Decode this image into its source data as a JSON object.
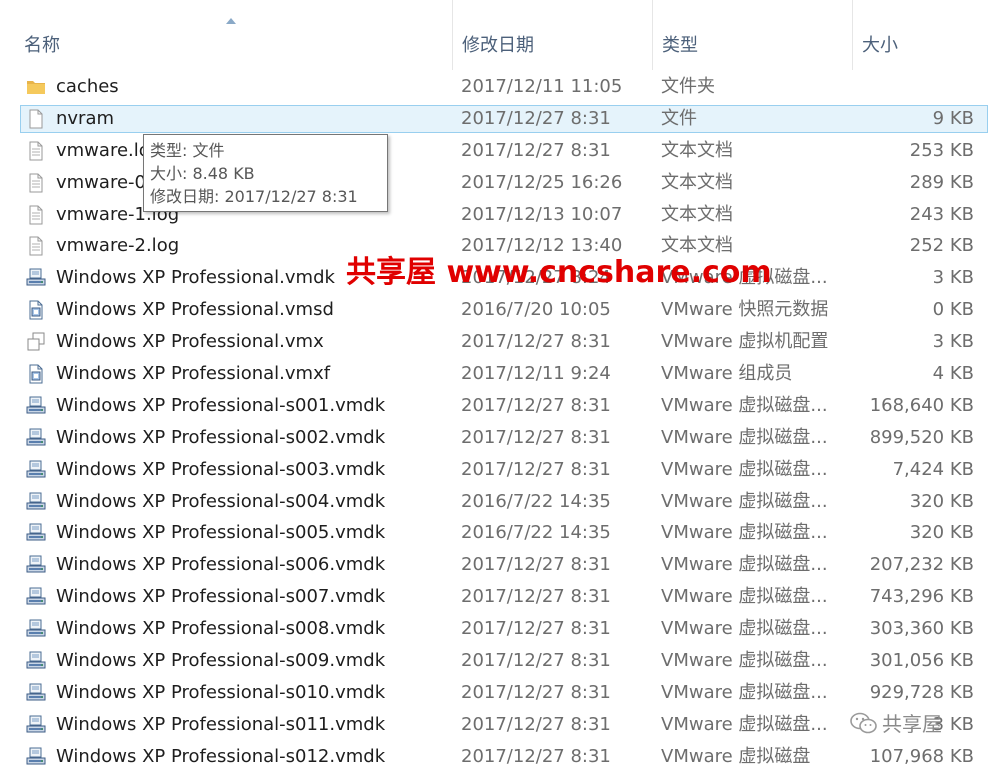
{
  "header": {
    "col_name": "名称",
    "col_date": "修改日期",
    "col_type": "类型",
    "col_size": "大小"
  },
  "files": [
    {
      "name": "caches",
      "date": "2017/12/11 11:05",
      "type": "文件夹",
      "size": "",
      "icon": "folder-icon"
    },
    {
      "name": "nvram",
      "date": "2017/12/27 8:31",
      "type": "文件",
      "size": "9 KB",
      "icon": "file-icon",
      "selected": true
    },
    {
      "name": "vmware.lo",
      "date": "2017/12/27 8:31",
      "type": "文本文档",
      "size": "253 KB",
      "icon": "text-file-icon"
    },
    {
      "name": "vmware-0",
      "date": "2017/12/25 16:26",
      "type": "文本文档",
      "size": "289 KB",
      "icon": "text-file-icon"
    },
    {
      "name": "vmware-1.log",
      "date": "2017/12/13 10:07",
      "type": "文本文档",
      "size": "243 KB",
      "icon": "text-file-icon"
    },
    {
      "name": "vmware-2.log",
      "date": "2017/12/12 13:40",
      "type": "文本文档",
      "size": "252 KB",
      "icon": "text-file-icon"
    },
    {
      "name": "Windows XP Professional.vmdk",
      "date": "2017/12/27 8:24",
      "type": "VMware 虚拟磁盘...",
      "size": "3 KB",
      "icon": "vmdk-disk-icon"
    },
    {
      "name": "Windows XP Professional.vmsd",
      "date": "2016/7/20 10:05",
      "type": "VMware 快照元数据",
      "size": "0 KB",
      "icon": "vmsd-file-icon"
    },
    {
      "name": "Windows XP Professional.vmx",
      "date": "2017/12/27 8:31",
      "type": "VMware 虚拟机配置",
      "size": "3 KB",
      "icon": "vmx-file-icon"
    },
    {
      "name": "Windows XP Professional.vmxf",
      "date": "2017/12/11 9:24",
      "type": "VMware 组成员",
      "size": "4 KB",
      "icon": "vmxf-file-icon"
    },
    {
      "name": "Windows XP Professional-s001.vmdk",
      "date": "2017/12/27 8:31",
      "type": "VMware 虚拟磁盘...",
      "size": "168,640 KB",
      "icon": "vmdk-disk-icon"
    },
    {
      "name": "Windows XP Professional-s002.vmdk",
      "date": "2017/12/27 8:31",
      "type": "VMware 虚拟磁盘...",
      "size": "899,520 KB",
      "icon": "vmdk-disk-icon"
    },
    {
      "name": "Windows XP Professional-s003.vmdk",
      "date": "2017/12/27 8:31",
      "type": "VMware 虚拟磁盘...",
      "size": "7,424 KB",
      "icon": "vmdk-disk-icon"
    },
    {
      "name": "Windows XP Professional-s004.vmdk",
      "date": "2016/7/22 14:35",
      "type": "VMware 虚拟磁盘...",
      "size": "320 KB",
      "icon": "vmdk-disk-icon"
    },
    {
      "name": "Windows XP Professional-s005.vmdk",
      "date": "2016/7/22 14:35",
      "type": "VMware 虚拟磁盘...",
      "size": "320 KB",
      "icon": "vmdk-disk-icon"
    },
    {
      "name": "Windows XP Professional-s006.vmdk",
      "date": "2017/12/27 8:31",
      "type": "VMware 虚拟磁盘...",
      "size": "207,232 KB",
      "icon": "vmdk-disk-icon"
    },
    {
      "name": "Windows XP Professional-s007.vmdk",
      "date": "2017/12/27 8:31",
      "type": "VMware 虚拟磁盘...",
      "size": "743,296 KB",
      "icon": "vmdk-disk-icon"
    },
    {
      "name": "Windows XP Professional-s008.vmdk",
      "date": "2017/12/27 8:31",
      "type": "VMware 虚拟磁盘...",
      "size": "303,360 KB",
      "icon": "vmdk-disk-icon"
    },
    {
      "name": "Windows XP Professional-s009.vmdk",
      "date": "2017/12/27 8:31",
      "type": "VMware 虚拟磁盘...",
      "size": "301,056 KB",
      "icon": "vmdk-disk-icon"
    },
    {
      "name": "Windows XP Professional-s010.vmdk",
      "date": "2017/12/27 8:31",
      "type": "VMware 虚拟磁盘...",
      "size": "929,728 KB",
      "icon": "vmdk-disk-icon"
    },
    {
      "name": "Windows XP Professional-s011.vmdk",
      "date": "2017/12/27 8:31",
      "type": "VMware 虚拟磁盘...",
      "size": "3 KB",
      "icon": "vmdk-disk-icon"
    },
    {
      "name": "Windows XP Professional-s012.vmdk",
      "date": "2017/12/27 8:31",
      "type": "VMware 虚拟磁盘",
      "size": "107,968 KB",
      "icon": "vmdk-disk-icon"
    }
  ],
  "tooltip": {
    "type_line": "类型: 文件",
    "size_line": "大小: 8.48 KB",
    "date_line": "修改日期: 2017/12/27 8:31"
  },
  "watermark": {
    "text": "共享屋 www.cncshare.com",
    "color": "#e00000"
  },
  "wechat_badge": {
    "text": "共享屋"
  },
  "colors": {
    "selection_bg": "#e5f3fb",
    "selection_border": "#99cfef",
    "header_text": "#4c607a"
  }
}
